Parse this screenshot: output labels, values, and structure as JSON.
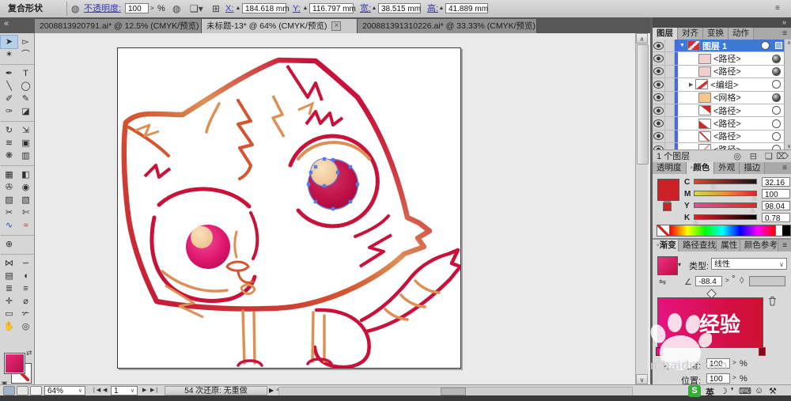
{
  "control_bar": {
    "title": "复合形状",
    "style_icon": "◍",
    "brush_icon": "❏",
    "ref_icon": "⊞",
    "menu_icon": "≡",
    "opacity_label": "不透明度:",
    "opacity_value": "100",
    "stepper": ">",
    "percent": "%",
    "x_label": "X:",
    "x_value": "184.618 mm",
    "y_label": "Y:",
    "y_value": "116.797 mm",
    "w_label": "宽:",
    "w_value": "38.515 mm",
    "h_label": "高:",
    "h_value": "41.889 mm"
  },
  "doc_tabs": {
    "collapse_left": "«",
    "collapse_right": "»",
    "items": [
      {
        "label": "2008813920791.ai* @ 12.5% (CMYK/预览)",
        "close": "×"
      },
      {
        "label": "未标题-13* @ 64% (CMYK/预览)",
        "close": "×"
      },
      {
        "label": "200881391310226.ai* @ 33.33% (CMYK/预览)",
        "close": "×"
      }
    ]
  },
  "toolbar": {
    "tools": [
      {
        "name": "selection",
        "glyph": "➤"
      },
      {
        "name": "direct-selection",
        "glyph": "▻"
      },
      {
        "name": "magic-wand",
        "glyph": "✶"
      },
      {
        "name": "lasso",
        "glyph": "⌒"
      },
      {
        "name": "pen",
        "glyph": "✒"
      },
      {
        "name": "type",
        "glyph": "T"
      },
      {
        "name": "line-segment",
        "glyph": "╲"
      },
      {
        "name": "ellipse",
        "glyph": "◯"
      },
      {
        "name": "paintbrush",
        "glyph": "✐"
      },
      {
        "name": "pencil",
        "glyph": "✎"
      },
      {
        "name": "blob-brush",
        "glyph": "✑"
      },
      {
        "name": "eraser",
        "glyph": "◪"
      },
      {
        "name": "rotate",
        "glyph": "↻"
      },
      {
        "name": "scale",
        "glyph": "⇲"
      },
      {
        "name": "warp",
        "glyph": "≋"
      },
      {
        "name": "free-transform",
        "glyph": "▣"
      },
      {
        "name": "symbol-sprayer",
        "glyph": "❋"
      },
      {
        "name": "column-graph",
        "glyph": "▥"
      },
      {
        "name": "mesh",
        "glyph": "▦"
      },
      {
        "name": "gradient",
        "glyph": "◧"
      },
      {
        "name": "eyedropper",
        "glyph": "✇"
      },
      {
        "name": "blend",
        "glyph": "◉"
      },
      {
        "name": "live-paint-bucket",
        "glyph": "▨"
      },
      {
        "name": "live-paint-selection",
        "glyph": "▧"
      },
      {
        "name": "crop-area",
        "glyph": "✂"
      },
      {
        "name": "slice",
        "glyph": "✄"
      },
      {
        "name": "path-curve",
        "glyph": "∿"
      },
      {
        "name": "scribble",
        "glyph": "≈"
      },
      {
        "name": "artboard",
        "glyph": "⊕"
      },
      {
        "name": "warp-flag",
        "glyph": "⋈"
      },
      {
        "name": "wave",
        "glyph": "∽"
      },
      {
        "name": "grid",
        "glyph": "▤"
      },
      {
        "name": "shell",
        "glyph": "◖"
      },
      {
        "name": "wrinkle",
        "glyph": "≣"
      },
      {
        "name": "columns",
        "glyph": "≡"
      },
      {
        "name": "measure-eyedropper",
        "glyph": "✛"
      },
      {
        "name": "measure",
        "glyph": "⌀"
      },
      {
        "name": "frame",
        "glyph": "▭"
      },
      {
        "name": "knife",
        "glyph": "✃"
      },
      {
        "name": "hand",
        "glyph": "✋"
      },
      {
        "name": "zoom",
        "glyph": "◎"
      }
    ]
  },
  "layers": {
    "tabs": [
      "图层",
      "对齐",
      "变换",
      "动作"
    ],
    "panel_menu": "≡",
    "expand_open": "▼",
    "expand_closed": "▶",
    "rows": [
      {
        "label": "图层 1"
      },
      {
        "label": "<路径>"
      },
      {
        "label": "<路径>"
      },
      {
        "label": "<编组>"
      },
      {
        "label": "<网格>"
      },
      {
        "label": "<路径>"
      },
      {
        "label": "<路径>"
      },
      {
        "label": "<路径>"
      },
      {
        "label": "<路径>"
      }
    ],
    "scroll_up": "∧",
    "scroll_down": "∨",
    "footer": "1 个图层",
    "btn_clip": "◎",
    "btn_sublayer": "⊟",
    "btn_new": "❏",
    "btn_delete": "⌦"
  },
  "color": {
    "tabs": [
      "透明度",
      "◦颜色",
      "外观",
      "描边"
    ],
    "panel_menu": "≡",
    "sliders": [
      {
        "label": "C",
        "value": "32.16"
      },
      {
        "label": "M",
        "value": "100"
      },
      {
        "label": "Y",
        "value": "98.04"
      },
      {
        "label": "K",
        "value": "0.78"
      }
    ],
    "unit": "%"
  },
  "gradient": {
    "tabs": [
      "◦渐变",
      "路径查找",
      "属性",
      "颜色参考"
    ],
    "panel_menu": "≡",
    "swatch_dd": "▾",
    "type_label": "类型:",
    "type_value": "线性",
    "type_dd": "∨",
    "reverse_icon": "⇋",
    "angle_icon": "∠",
    "angle_value": "-88.4",
    "stepper": ">",
    "degree": "°",
    "aspect_icon": "◊",
    "opacity_label": "不透明度:",
    "opacity_value": "100",
    "position_label": "位置:",
    "position_value": "100",
    "unit": "%"
  },
  "status": {
    "zoom": "64%",
    "zoom_dd": "∨",
    "first": "❘◀",
    "prev": "◀",
    "artboard": "1",
    "artboard_dd": "∨",
    "next": "▶",
    "last": "▶❘",
    "history": "54 次还原: 无重做",
    "more": "▶",
    "back": "<"
  },
  "ime": {
    "logo": "S",
    "lang": "英",
    "moon": "☽",
    "punct": "❜",
    "keyboard": "⌨",
    "person": "☺",
    "wrench": "⚒"
  },
  "watermark": {
    "brand": "经验",
    "domain": "n.baidu.com"
  },
  "colors": {
    "selection_blue": "#3c78d8",
    "anchor_blue": "#5b7be0",
    "fill_pink": "#e0206e",
    "line_crimson": "#c8123a",
    "line_orange": "#dd9055",
    "gradient_left": "#e5137f",
    "gradient_right": "#ce1030",
    "swatch_red": "#cc2127"
  }
}
